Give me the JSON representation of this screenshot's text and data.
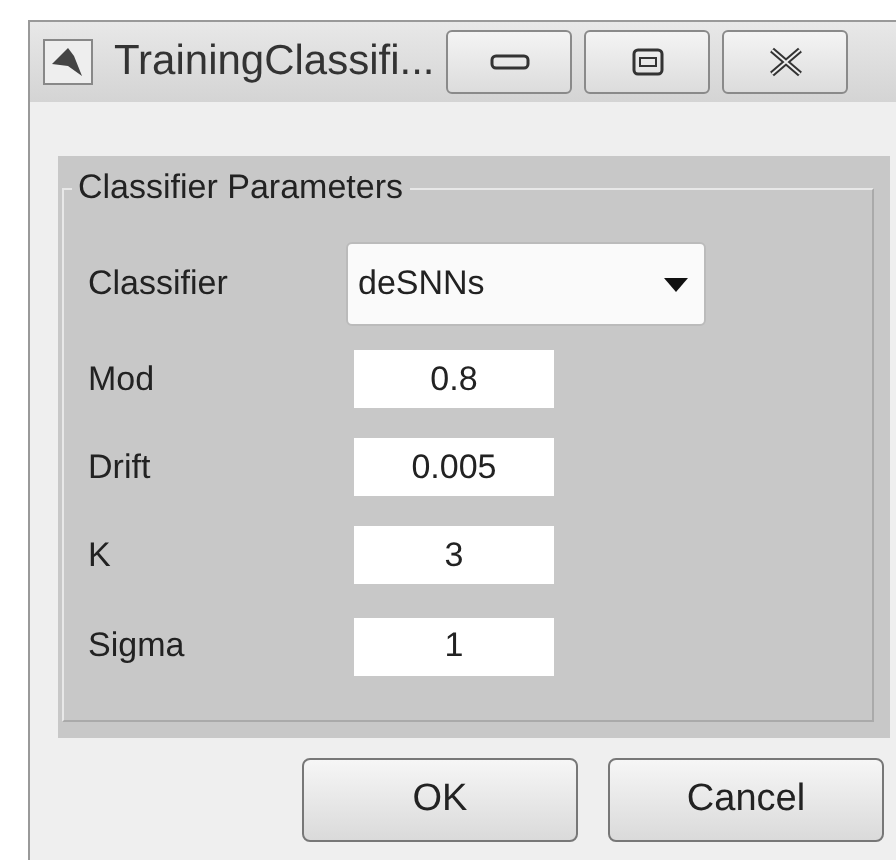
{
  "window": {
    "title": "TrainingClassifi..."
  },
  "panel": {
    "title": "Classifier Parameters",
    "dropdown": {
      "label": "Classifier",
      "value": "deSNNs"
    },
    "fields": [
      {
        "label": "Mod",
        "value": "0.8"
      },
      {
        "label": "Drift",
        "value": "0.005"
      },
      {
        "label": "K",
        "value": "3"
      },
      {
        "label": "Sigma",
        "value": "1"
      }
    ]
  },
  "buttons": [
    {
      "label": "OK"
    },
    {
      "label": "Cancel"
    }
  ]
}
